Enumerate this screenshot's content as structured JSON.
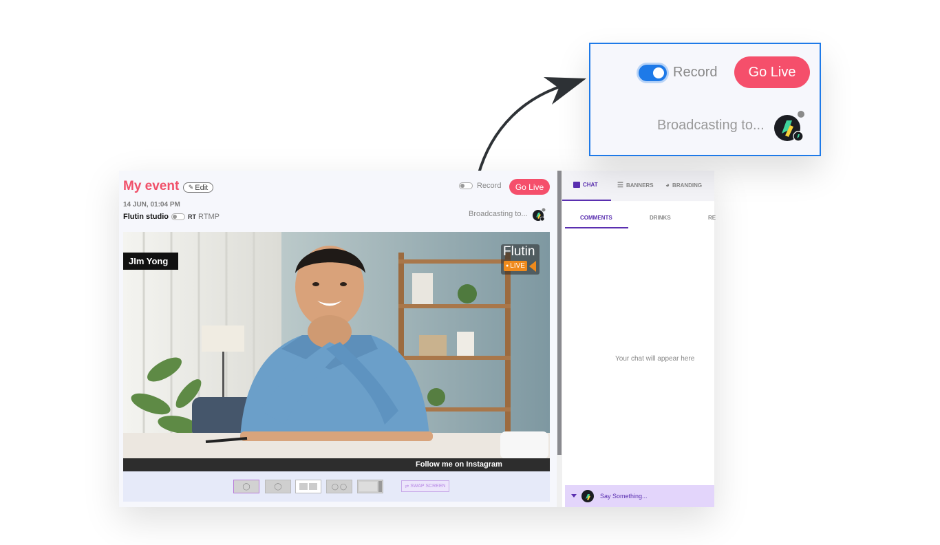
{
  "event": {
    "title": "My event",
    "edit_label": "Edit",
    "date": "14 JUN, 01:04 PM",
    "studio_label": "Flutin studio",
    "rtmp_label": "RTMP"
  },
  "header": {
    "record_label": "Record",
    "go_live_label": "Go Live",
    "broadcasting_label": "Broadcasting to..."
  },
  "video": {
    "name_tag": "JIm Yong",
    "brand_name": "Flutin",
    "live_badge": "LIVE",
    "caption": "Follow me on Instagram"
  },
  "layouts": {
    "swap_label": "SWAP SCREEN"
  },
  "sidebar": {
    "tabs": [
      {
        "label": "CHAT",
        "icon": "chat-icon"
      },
      {
        "label": "BANNERS",
        "icon": "banners-icon"
      },
      {
        "label": "BRANDING",
        "icon": "palette-icon"
      }
    ],
    "subtabs": [
      "COMMENTS",
      "DRINKS",
      "RE"
    ],
    "empty_text": "Your chat will appear here",
    "input_placeholder": "Say Something..."
  },
  "zoom": {
    "record_label": "Record",
    "go_live_label": "Go Live",
    "broadcasting_label": "Broadcasting to..."
  },
  "colors": {
    "brand_pink": "#f54f6b",
    "accent_purple": "#5a2fb0",
    "toggle_blue": "#1e7ae8"
  }
}
